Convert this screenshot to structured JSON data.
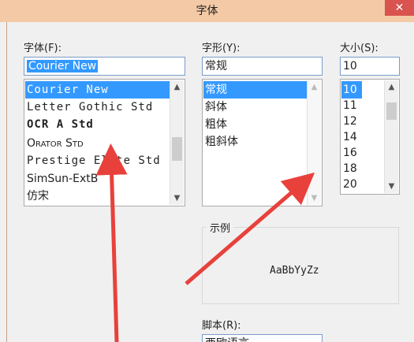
{
  "window": {
    "title": "字体",
    "close_label": "✕"
  },
  "font": {
    "label": "字体(F):",
    "value": "Courier New",
    "items": [
      "Courier New",
      "Letter Gothic Std",
      "OCR A Std",
      "Orator Std",
      "Prestige Elite Std",
      "SimSun-ExtB",
      "仿宋"
    ]
  },
  "style": {
    "label": "字形(Y):",
    "value": "常规",
    "items": [
      "常规",
      "斜体",
      "粗体",
      "粗斜体"
    ]
  },
  "size": {
    "label": "大小(S):",
    "value": "10",
    "items": [
      "10",
      "11",
      "12",
      "14",
      "16",
      "18",
      "20"
    ]
  },
  "sample": {
    "group_label": "示例",
    "text": "AaBbYyZz"
  },
  "script": {
    "label": "脚本(R):",
    "value": "西欧语言"
  },
  "icons": [
    "close-icon",
    "scroll-up-icon",
    "scroll-down-icon",
    "annotation-arrow"
  ],
  "colors": {
    "selection": "#3399ff",
    "annotation": "#e8413c",
    "title_bar": "#f4c9a6"
  }
}
